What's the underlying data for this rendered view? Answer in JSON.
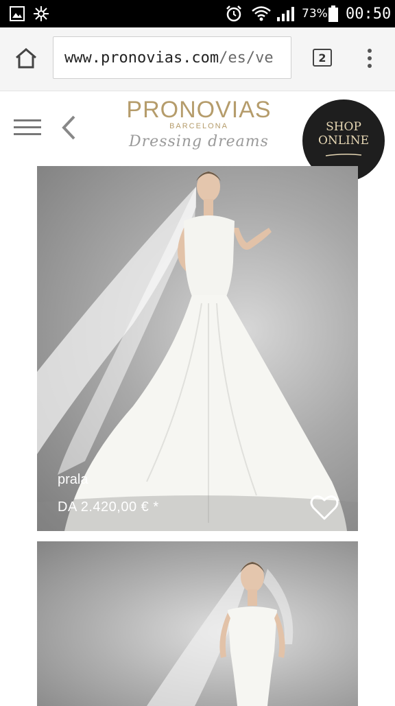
{
  "status_bar": {
    "battery_percent": "73%",
    "time": "00:50"
  },
  "browser": {
    "url_host": "www.pronovias.com",
    "url_path": "/es/ve",
    "tab_count": "2"
  },
  "site_header": {
    "brand_name": "PRONOVIAS",
    "brand_city": "BARCELONA",
    "tagline": "Dressing dreams",
    "shop_online_line1": "SHOP",
    "shop_online_line2": "ONLINE"
  },
  "products": [
    {
      "name": "prala",
      "price": "DA 2.420,00 € *"
    },
    {
      "name": "",
      "price": ""
    }
  ],
  "colors": {
    "brand_gold": "#b59c6b",
    "status_bar": "#000000",
    "browser_chrome": "#f5f5f5"
  },
  "icons": [
    "image-icon",
    "settings-burst-icon",
    "alarm-icon",
    "wifi-icon",
    "signal-icon",
    "battery-icon",
    "home-icon",
    "tabs-icon",
    "overflow-menu-icon",
    "hamburger-menu-icon",
    "back-chevron-icon",
    "heart-icon"
  ]
}
